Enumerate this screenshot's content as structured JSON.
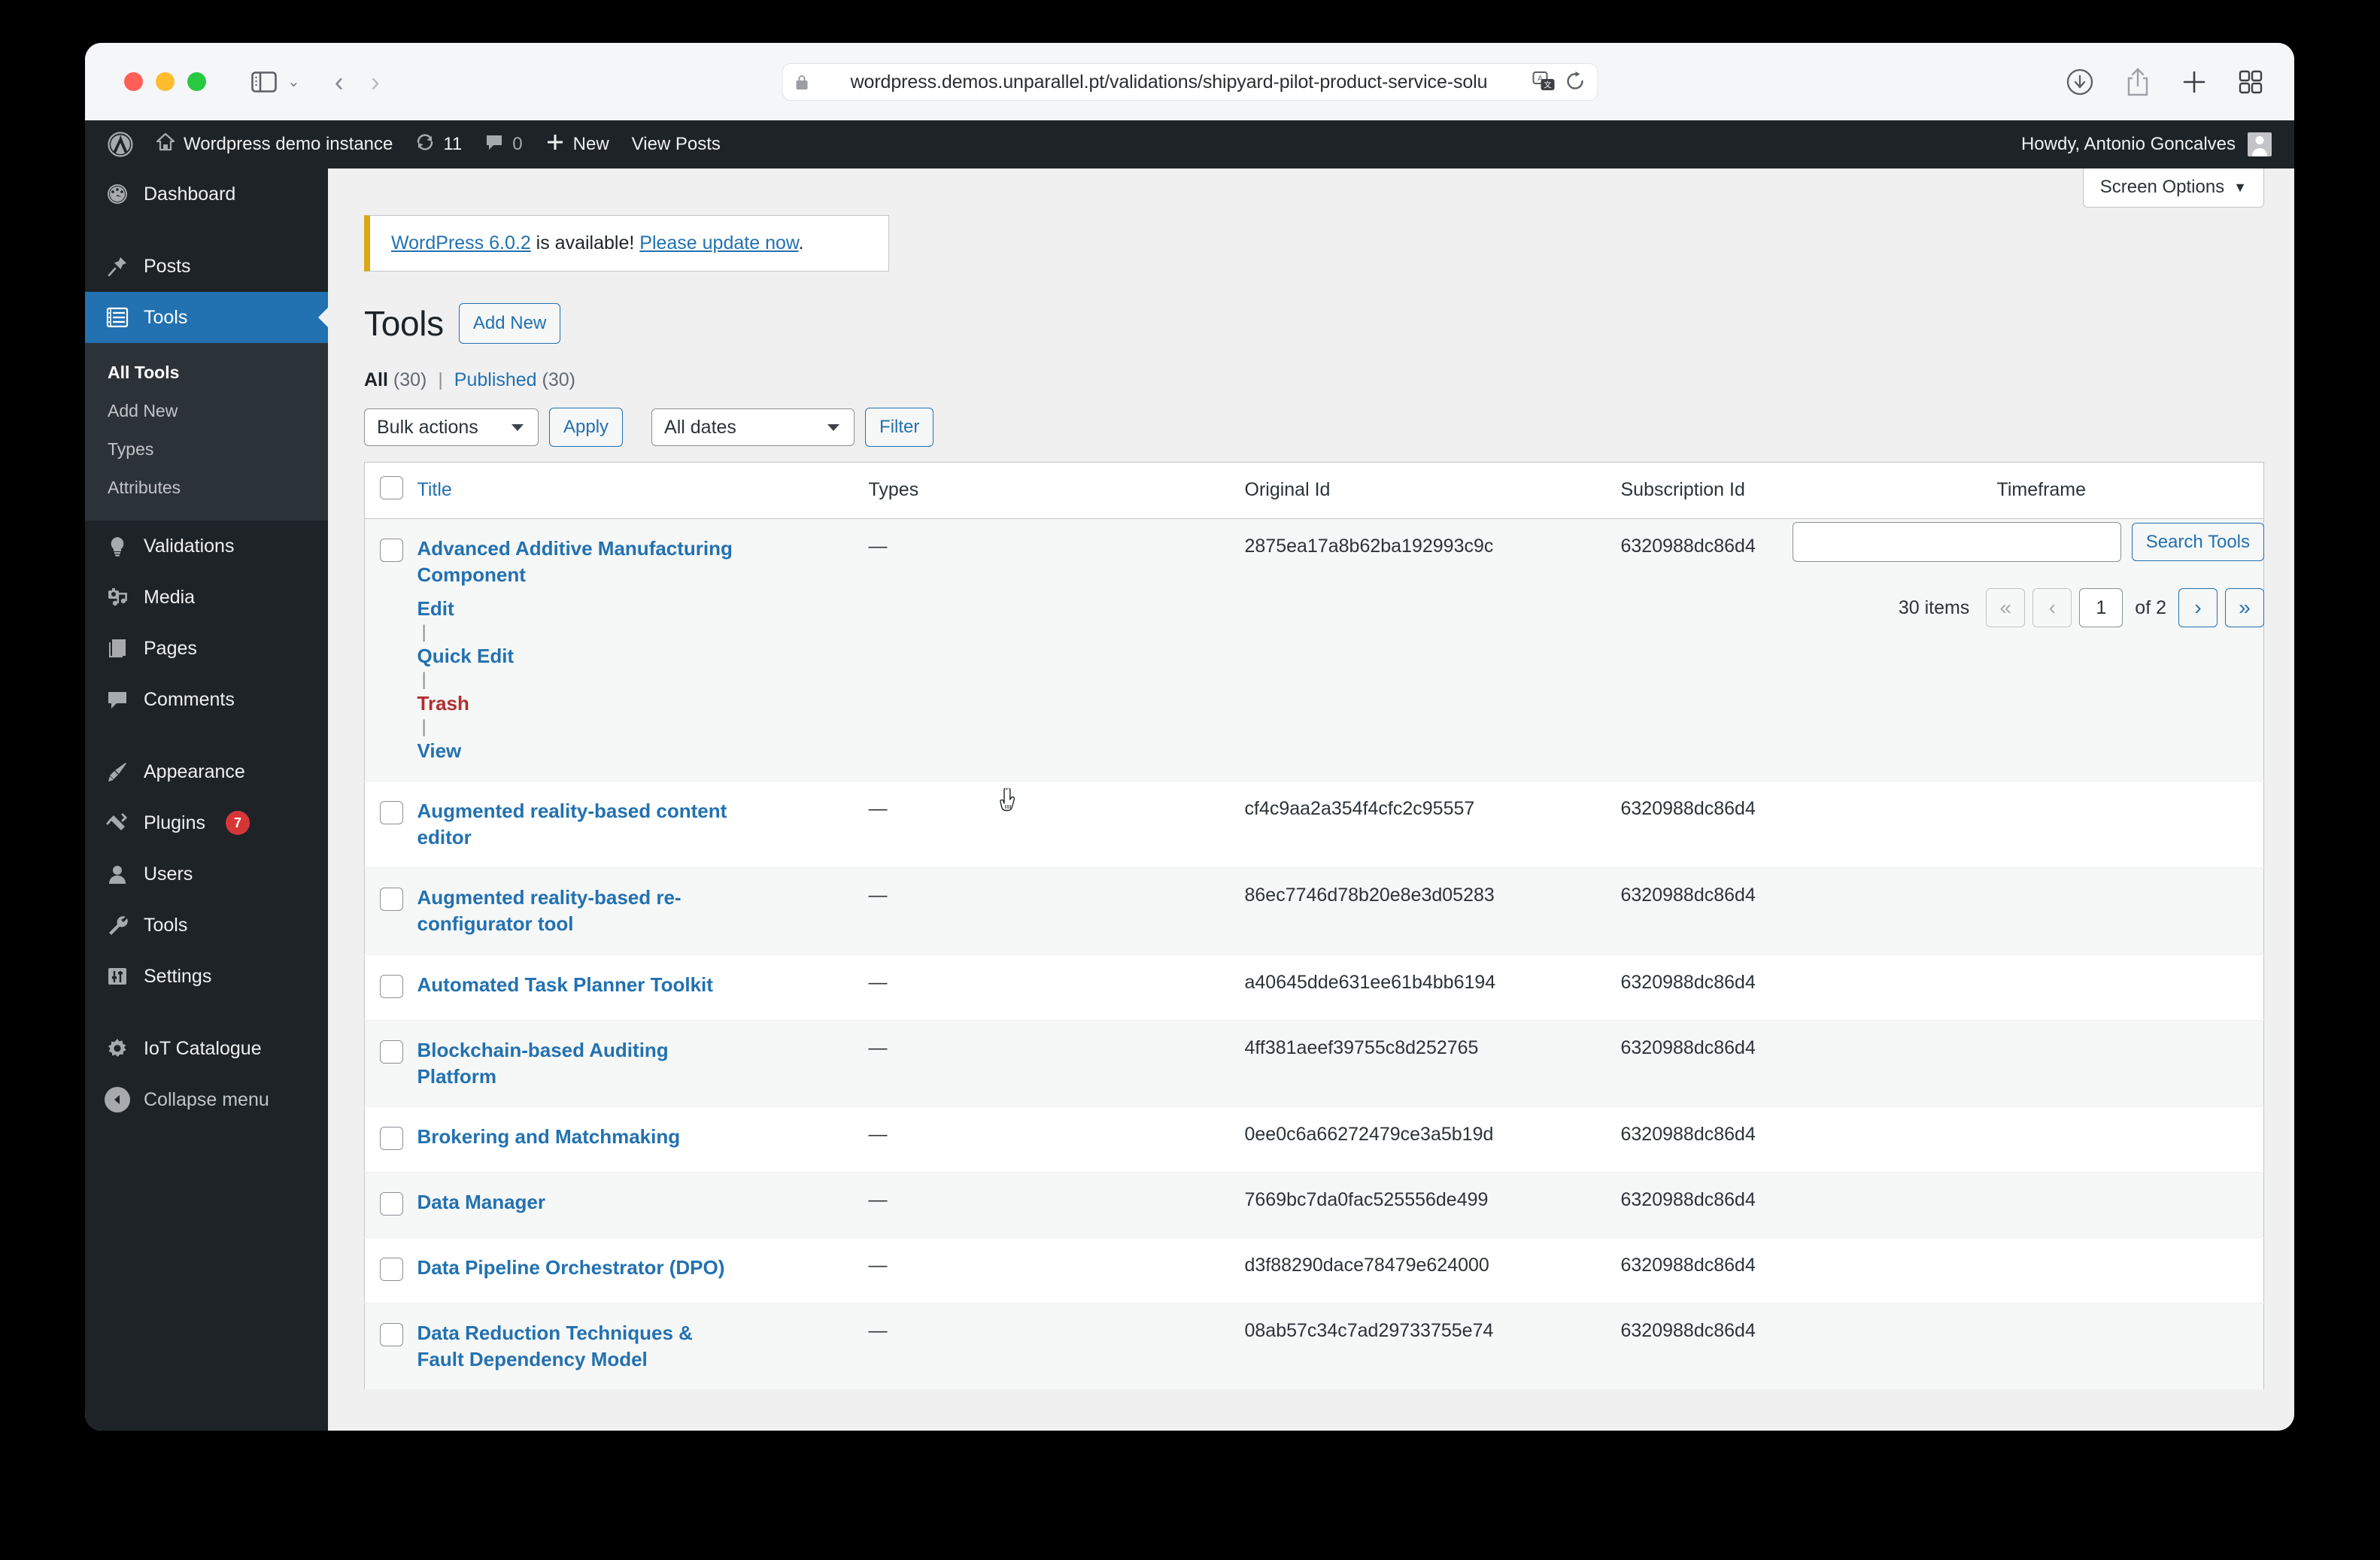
{
  "browser": {
    "url": "wordpress.demos.unparallel.pt/validations/shipyard-pilot-product-service-solu",
    "icons": {
      "sidebar": "sidebar-toggle-icon",
      "chevron": "chevron-down-icon",
      "back": "back-arrow-icon",
      "forward": "forward-arrow-icon",
      "shield": "shield-icon",
      "lock": "lock-icon",
      "translate": "translate-icon",
      "reload": "reload-icon",
      "download": "download-icon",
      "share": "share-icon",
      "newtab": "plus-icon",
      "tabs": "tab-overview-icon"
    }
  },
  "adminbar": {
    "logo": "wordpress-logo-icon",
    "site_name": "Wordpress demo instance",
    "updates_count": "11",
    "comments_count": "0",
    "new_label": "New",
    "view_posts_label": "View Posts",
    "howdy": "Howdy, Antonio Goncalves"
  },
  "sidebar": {
    "items": [
      {
        "label": "Dashboard",
        "icon": "dashboard-icon",
        "current": false
      },
      {
        "label": "Posts",
        "icon": "pin-icon",
        "current": false
      },
      {
        "label": "Tools",
        "icon": "list-view-icon",
        "current": true
      },
      {
        "label": "Validations",
        "icon": "lightbulb-icon",
        "current": false
      },
      {
        "label": "Media",
        "icon": "media-icon",
        "current": false
      },
      {
        "label": "Pages",
        "icon": "pages-icon",
        "current": false
      },
      {
        "label": "Comments",
        "icon": "comment-icon",
        "current": false
      },
      {
        "label": "Appearance",
        "icon": "paintbrush-icon",
        "current": false
      },
      {
        "label": "Plugins",
        "icon": "plug-icon",
        "current": false,
        "badge": "7"
      },
      {
        "label": "Users",
        "icon": "user-icon",
        "current": false
      },
      {
        "label": "Tools",
        "icon": "wrench-icon",
        "current": false
      },
      {
        "label": "Settings",
        "icon": "settings-sliders-icon",
        "current": false
      },
      {
        "label": "IoT Catalogue",
        "icon": "gear-icon",
        "current": false
      },
      {
        "label": "Collapse menu",
        "icon": "collapse-arrow-icon",
        "current": false
      }
    ],
    "submenu": [
      {
        "label": "All Tools",
        "current": true
      },
      {
        "label": "Add New",
        "current": false
      },
      {
        "label": "Types",
        "current": false
      },
      {
        "label": "Attributes",
        "current": false
      }
    ]
  },
  "screen_options": {
    "label": "Screen Options",
    "caret": "▼"
  },
  "notice": {
    "link_version": "WordPress 6.0.2",
    "middle": " is available! ",
    "link_update": "Please update now",
    "tail": "."
  },
  "page": {
    "title": "Tools",
    "add_new_label": "Add New"
  },
  "views": {
    "all_label": "All",
    "all_count": "(30)",
    "separator": "|",
    "published_label": "Published",
    "published_count": "(30)"
  },
  "tablenav": {
    "bulk_actions_value": "Bulk actions",
    "apply_label": "Apply",
    "dates_value": "All dates",
    "filter_label": "Filter"
  },
  "search": {
    "value": "",
    "placeholder": "",
    "button_label": "Search Tools"
  },
  "pagination": {
    "items_label": "30 items",
    "first": "«",
    "prev": "‹",
    "current_page": "1",
    "of_label": "of 2",
    "next": "›",
    "last": "»"
  },
  "table": {
    "columns": [
      "Title",
      "Types",
      "Original Id",
      "Subscription Id",
      "Timeframe"
    ],
    "row_actions": {
      "edit": "Edit",
      "quick_edit": "Quick Edit",
      "trash": "Trash",
      "view": "View"
    },
    "rows": [
      {
        "title": "Advanced Additive Manufacturing Component",
        "types": "—",
        "original_id": "2875ea17a8b62ba192993c9c",
        "subscription_id": "6320988dc86d4",
        "timeframe": ""
      },
      {
        "title": "Augmented reality-based content editor",
        "types": "—",
        "original_id": "cf4c9aa2a354f4cfc2c95557",
        "subscription_id": "6320988dc86d4",
        "timeframe": ""
      },
      {
        "title": "Augmented reality-based re-configurator tool",
        "types": "—",
        "original_id": "86ec7746d78b20e8e3d05283",
        "subscription_id": "6320988dc86d4",
        "timeframe": ""
      },
      {
        "title": "Automated Task Planner Toolkit",
        "types": "—",
        "original_id": "a40645dde631ee61b4bb6194",
        "subscription_id": "6320988dc86d4",
        "timeframe": ""
      },
      {
        "title": "Blockchain-based Auditing Platform",
        "types": "—",
        "original_id": "4ff381aeef39755c8d252765",
        "subscription_id": "6320988dc86d4",
        "timeframe": ""
      },
      {
        "title": "Brokering and Matchmaking",
        "types": "—",
        "original_id": "0ee0c6a66272479ce3a5b19d",
        "subscription_id": "6320988dc86d4",
        "timeframe": ""
      },
      {
        "title": "Data Manager",
        "types": "—",
        "original_id": "7669bc7da0fac525556de499",
        "subscription_id": "6320988dc86d4",
        "timeframe": ""
      },
      {
        "title": "Data Pipeline Orchestrator (DPO)",
        "types": "—",
        "original_id": "d3f88290dace78479e624000",
        "subscription_id": "6320988dc86d4",
        "timeframe": ""
      },
      {
        "title": "Data Reduction Techniques & Fault Dependency Model",
        "types": "—",
        "original_id": "08ab57c34c7ad29733755e74",
        "subscription_id": "6320988dc86d4",
        "timeframe": ""
      }
    ]
  },
  "colors": {
    "wp_blue": "#2271b1",
    "admin_dark": "#1d2327",
    "submenu_dark": "#2c3338",
    "notice_yellow": "#dba617",
    "badge_red": "#d63638",
    "trash_red": "#b32d2e"
  }
}
